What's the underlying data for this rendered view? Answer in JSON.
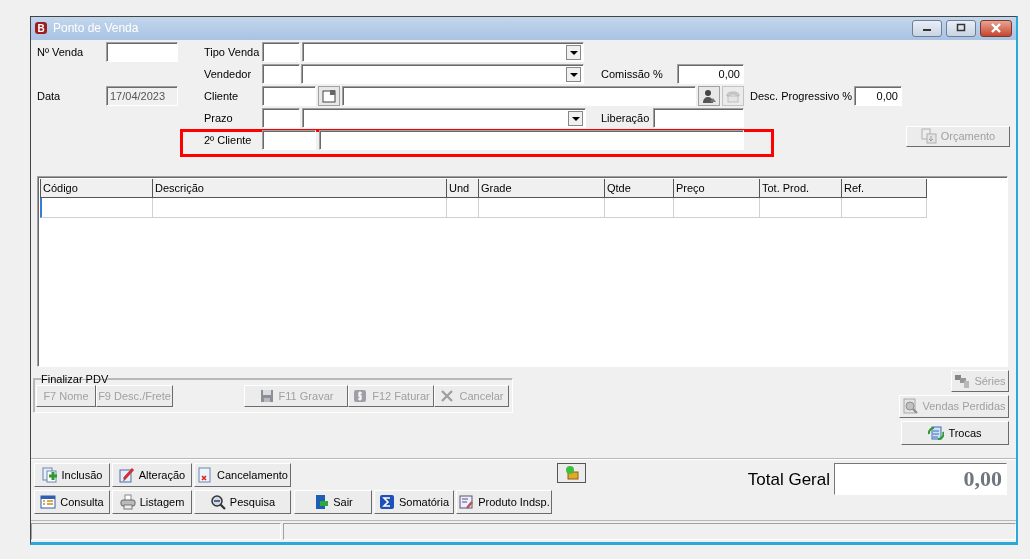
{
  "window": {
    "title": "Ponto de Venda",
    "app_letter": "B"
  },
  "form": {
    "numero_venda": {
      "label": "Nº Venda"
    },
    "data": {
      "label": "Data",
      "value": "17/04/2023",
      "disabled": true
    },
    "tipo_venda": {
      "label": "Tipo Venda"
    },
    "vendedor": {
      "label": "Vendedor"
    },
    "comissao": {
      "label": "Comissão %",
      "value": "0,00"
    },
    "cliente": {
      "label": "Cliente",
      "buttons": [
        {
          "kind": "card",
          "disabled": false
        },
        {
          "kind": "person",
          "disabled": false
        },
        {
          "kind": "phone",
          "disabled": true
        }
      ]
    },
    "desc_progressivo": {
      "label": "Desc. Progressivo %",
      "value": "0,00"
    },
    "prazo": {
      "label": "Prazo"
    },
    "liberacao": {
      "label": "Liberação"
    },
    "segundo_cliente": {
      "label": "2º Cliente",
      "highlighted": true
    }
  },
  "orcamento_button": {
    "label": "Orçamento",
    "kind": "budget",
    "disabled": true
  },
  "table": {
    "columns": [
      "Código",
      "Descrição",
      "Und",
      "Grade",
      "Qtde",
      "Preço",
      "Tot. Prod.",
      "Ref."
    ]
  },
  "finalizar": {
    "title": "Finalizar PDV",
    "buttons": [
      {
        "label": "F7  Nome",
        "kind": "text",
        "disabled": true
      },
      {
        "label": "F9 Desc./Frete",
        "kind": "text",
        "disabled": true
      },
      {
        "label": "F11  Gravar",
        "kind": "save",
        "disabled": true
      },
      {
        "label": "F12  Faturar",
        "kind": "dollar",
        "disabled": true
      },
      {
        "label": "Cancelar",
        "kind": "cross",
        "disabled": true
      }
    ]
  },
  "side_buttons": [
    {
      "label": "Séries",
      "kind": "series",
      "disabled": true
    },
    {
      "label": "Vendas Perdidas",
      "kind": "lost",
      "disabled": true
    },
    {
      "label": "Trocas",
      "kind": "swap",
      "disabled": false
    }
  ],
  "action_rows": [
    [
      {
        "label": "Inclusão",
        "kind": "add",
        "disabled": false
      },
      {
        "label": "Alteração",
        "kind": "edit",
        "disabled": false
      },
      {
        "label": "Cancelamento",
        "kind": "cancel",
        "disabled": false
      }
    ],
    [
      {
        "label": "Consulta",
        "kind": "list",
        "disabled": false
      },
      {
        "label": "Listagem",
        "kind": "print",
        "disabled": false
      },
      {
        "label": "Pesquisa",
        "kind": "search",
        "disabled": false
      },
      {
        "label": "Sair",
        "kind": "exit",
        "disabled": false
      },
      {
        "label": "Somatória",
        "kind": "sigma",
        "disabled": false
      },
      {
        "label": "Produto Indsp.",
        "kind": "product",
        "disabled": false
      }
    ]
  ],
  "cash_button": {
    "kind": "money",
    "disabled": false
  },
  "total": {
    "label": "Total Geral",
    "value": "0,00"
  }
}
